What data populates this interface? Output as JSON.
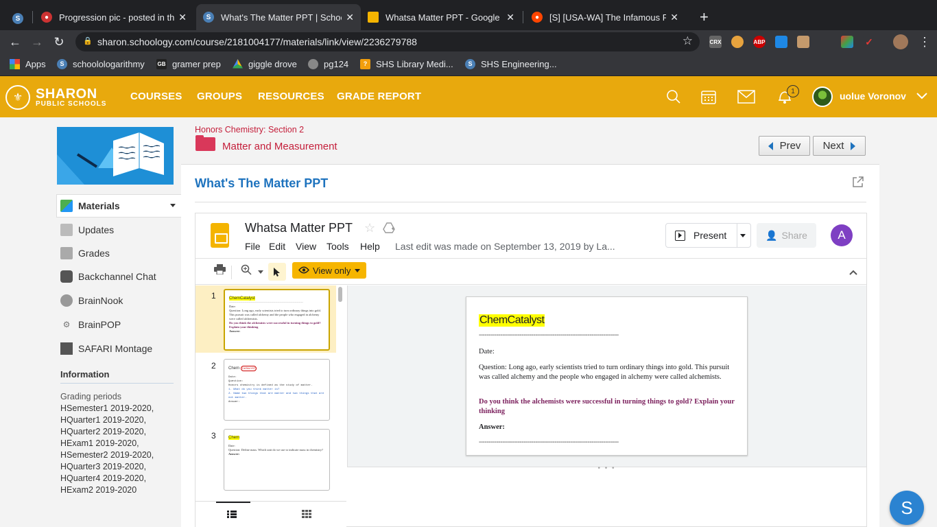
{
  "browser": {
    "tabs": [
      {
        "title": "Progression pic - posted in the"
      },
      {
        "title": "What's The Matter PPT | Schoo"
      },
      {
        "title": "Whatsa Matter PPT - Google Sl"
      },
      {
        "title": "[S] [USA-WA] The Infamous Pa"
      }
    ],
    "url": "sharon.schoology.com/course/2181004177/materials/link/view/2236279788",
    "bookmarks": [
      "Apps",
      "schoolologarithmy",
      "gramer prep",
      "giggle drove",
      "pg124",
      "SHS Library Medi...",
      "SHS Engineering..."
    ],
    "extensions": {
      "crx": "CRX",
      "abp": "ABP"
    }
  },
  "header": {
    "logo_line1": "SHARON",
    "logo_line2": "PUBLIC SCHOOLS",
    "nav": [
      "COURSES",
      "GROUPS",
      "RESOURCES",
      "GRADE REPORT"
    ],
    "notification_count": "1",
    "user_name": "uolue Voronov"
  },
  "sidebar": {
    "items": [
      "Materials",
      "Updates",
      "Grades",
      "Backchannel Chat",
      "BrainNook",
      "BrainPOP",
      "SAFARI Montage"
    ],
    "info_heading": "Information",
    "grading_label": "Grading periods",
    "grading_periods": [
      "HSemester1 2019-2020,",
      "HQuarter1 2019-2020,",
      "HQuarter2 2019-2020,",
      "HExam1 2019-2020,",
      "HSemester2 2019-2020,",
      "HQuarter3 2019-2020,",
      "HQuarter4 2019-2020,",
      "HExam2 2019-2020"
    ]
  },
  "main": {
    "breadcrumb": "Honors Chemistry: Section 2",
    "folder_title": "Matter and Measurement",
    "prev_label": "Prev",
    "next_label": "Next",
    "page_title": "What's The Matter PPT"
  },
  "slides": {
    "doc_title": "Whatsa Matter PPT",
    "menu": [
      "File",
      "Edit",
      "View",
      "Tools",
      "Help"
    ],
    "last_edit": "Last edit was made on September 13, 2019 by La...",
    "present_label": "Present",
    "share_label": "Share",
    "account_initial": "A",
    "view_only_label": "View only",
    "thumb_numbers": [
      "1",
      "2",
      "3"
    ],
    "current_slide": {
      "title": "ChemCatalyst",
      "divider": "------------------------------------------------------------------------",
      "date_label": "Date:",
      "question": "Question:   Long ago, early scientists tried to turn ordinary things into gold. This pursuit was called alchemy and the people who engaged in alchemy were called alchemists.",
      "prompt": "Do you think the alchemists were successful in turning things to gold? Explain your thinking",
      "answer_label": "Answer:",
      "prompt_color": "#7b1f5c"
    },
    "thumb2": {
      "title": "Chem",
      "logo_text": "CATALYST",
      "date": "Date:",
      "question": "Question:",
      "line1": "Honors chemistry is defined as the study of matter.",
      "item1": "1.  What do you think matter is?",
      "item2": "2.  Name two things that are matter and two things that are not matter.",
      "answer": "Answer:"
    },
    "thumb3": {
      "title": "Chem",
      "date": "Date:",
      "question": "Question:   Define mass. Which unit do we use to indicate mass in chemistry?",
      "answer": "Answer:"
    }
  },
  "colors": {
    "header_bg": "#e8a90d",
    "title_blue": "#1e73be",
    "crumb_red": "#c41e3a",
    "view_only_yellow": "#f6b500"
  }
}
